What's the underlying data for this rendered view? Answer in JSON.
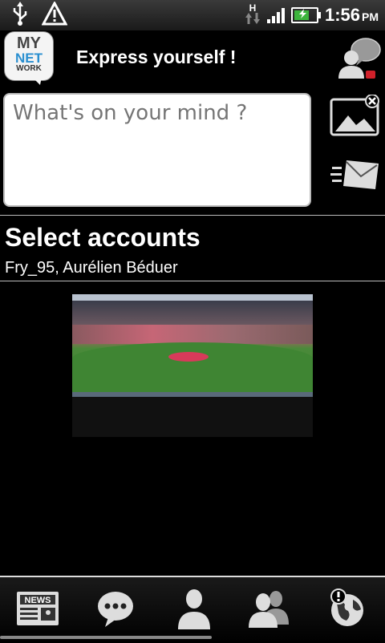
{
  "status_bar": {
    "time": "1:56",
    "ampm": "PM",
    "network_type": "H",
    "battery_percent": 70,
    "signal_bars": 4
  },
  "header": {
    "logo": {
      "line1": "MY",
      "line2": "NET",
      "line3": "WORK"
    },
    "title": "Express yourself !"
  },
  "composer": {
    "placeholder": "What's on your mind ?",
    "value": ""
  },
  "accounts": {
    "heading": "Select accounts",
    "selected": "Fry_95, Aurélien Béduer"
  },
  "bottom_nav": {
    "items": [
      "news-icon",
      "chat-bubble-icon",
      "person-icon",
      "people-icon",
      "globe-alert-icon"
    ]
  },
  "colors": {
    "accent_green": "#3cb43c",
    "logo_blue": "#2a8fd0",
    "badge_red": "#d0202a"
  }
}
